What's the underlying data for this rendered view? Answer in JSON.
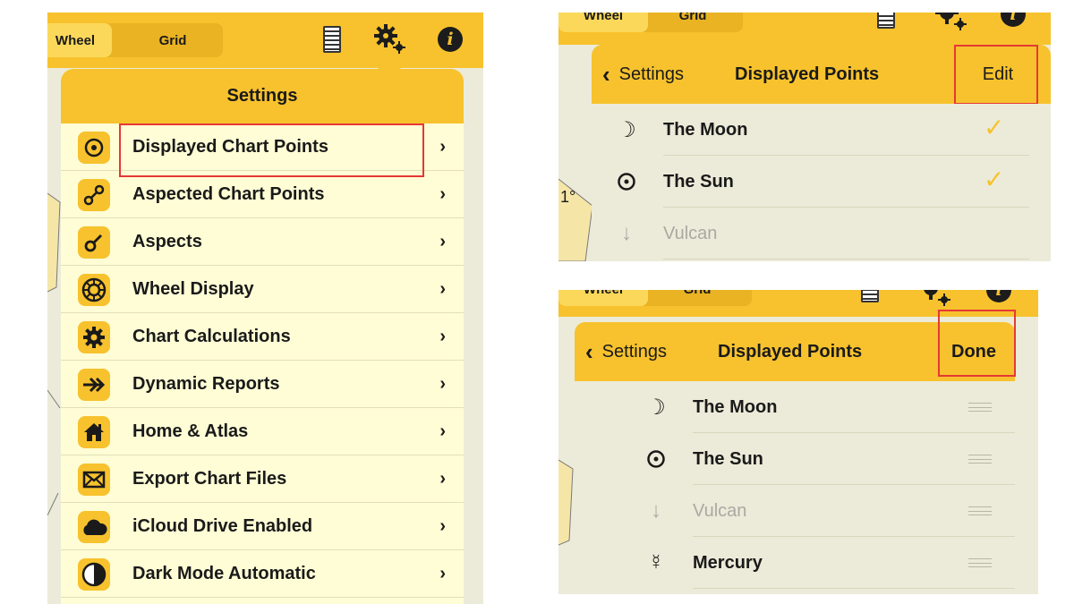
{
  "toolbar": {
    "wheel_tab": "Wheel",
    "grid_tab": "Grid",
    "info_glyph": "i"
  },
  "toolbar_partial": {
    "wheel_tab": "Wheel",
    "grid_tab": "Grid"
  },
  "settings": {
    "title": "Settings",
    "items": [
      {
        "label": "Displayed Chart Points",
        "icon": "target-icon"
      },
      {
        "label": "Aspected Chart Points",
        "icon": "link-icon"
      },
      {
        "label": "Aspects",
        "icon": "conjunction-icon"
      },
      {
        "label": "Wheel Display",
        "icon": "wheel-icon"
      },
      {
        "label": "Chart Calculations",
        "icon": "gear-icon"
      },
      {
        "label": "Dynamic Reports",
        "icon": "arrow-icon"
      },
      {
        "label": "Home & Atlas",
        "icon": "home-icon"
      },
      {
        "label": "Export Chart Files",
        "icon": "envelope-icon"
      },
      {
        "label": "iCloud Drive Enabled",
        "icon": "cloud-icon"
      },
      {
        "label": "Dark Mode Automatic",
        "icon": "half-circle-icon"
      }
    ]
  },
  "chart_fragment": {
    "degree_label": "1°"
  },
  "displayed_points": {
    "back_label": "Settings",
    "title": "Displayed Points",
    "edit_label": "Edit",
    "done_label": "Done",
    "points": [
      {
        "name": "The Moon",
        "symbol": "☽",
        "enabled": true
      },
      {
        "name": "The Sun",
        "symbol": "☉",
        "enabled": true
      },
      {
        "name": "Vulcan",
        "symbol": "↓",
        "enabled": false
      },
      {
        "name": "Mercury",
        "symbol": "☿",
        "enabled": true
      }
    ]
  },
  "colors": {
    "accent": "#f7c22d",
    "row_bg": "#fffdd5",
    "highlight_box": "#e53935",
    "check": "#f7c22d"
  }
}
